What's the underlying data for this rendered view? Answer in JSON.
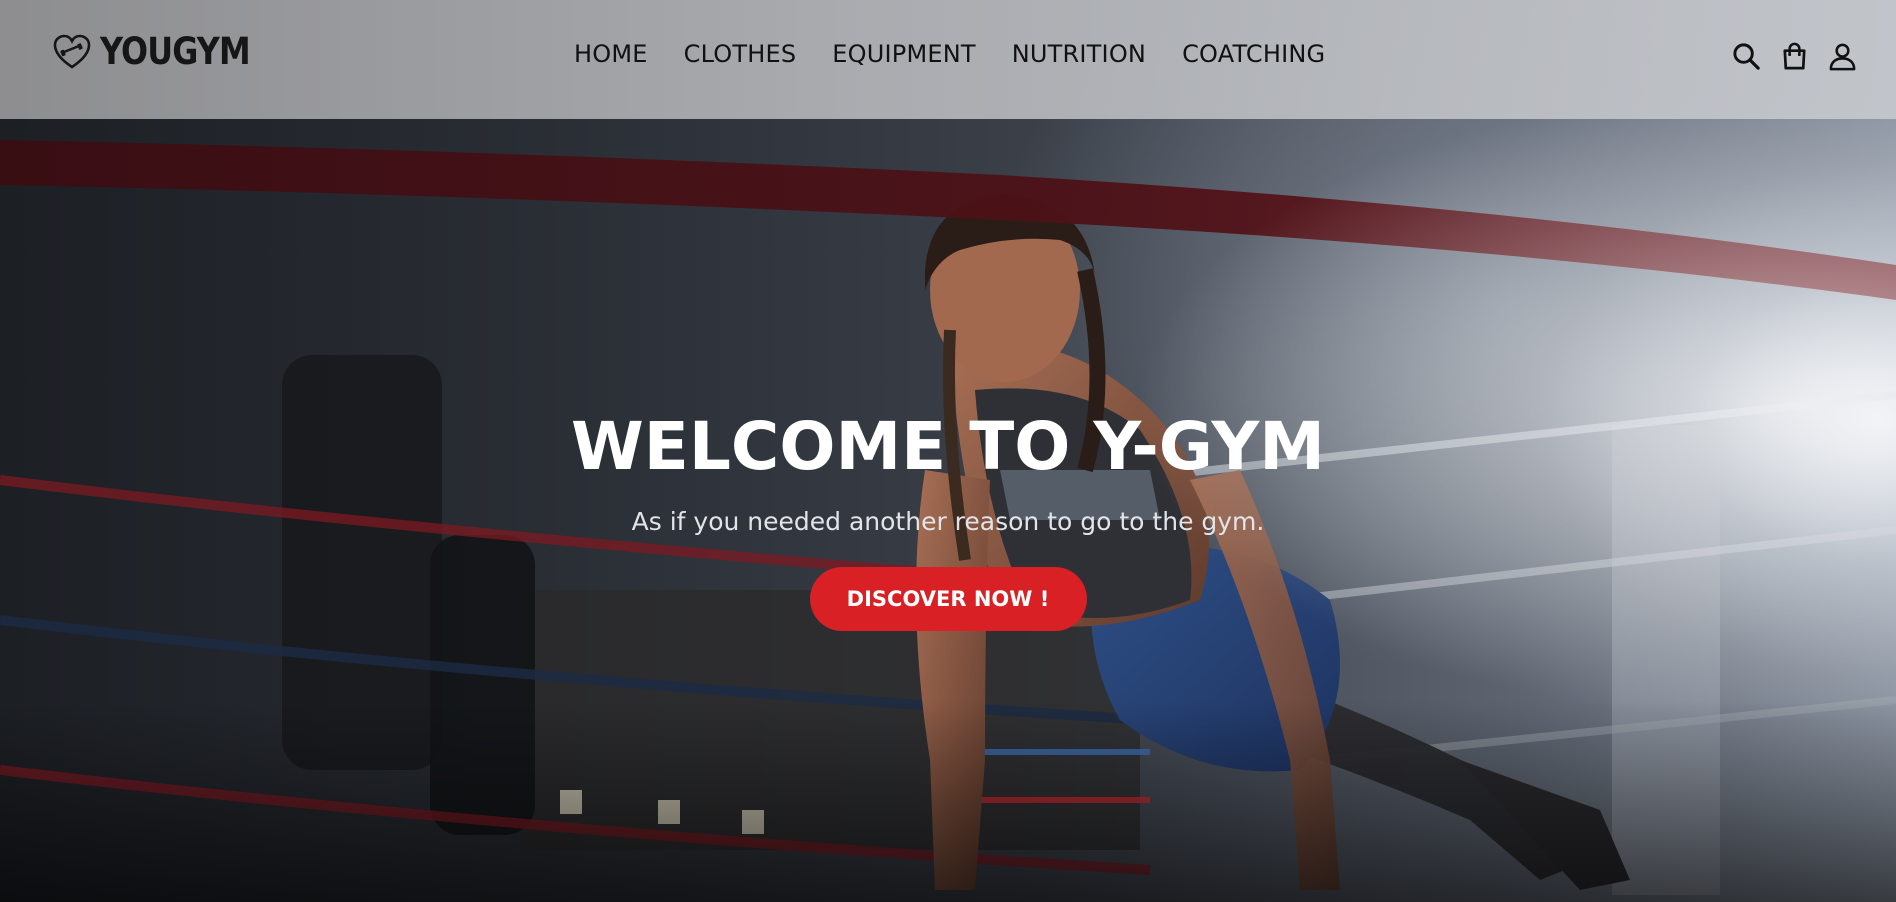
{
  "brand": {
    "name": "YOUGYM",
    "logo_icon": "heart-dumbbell-icon"
  },
  "nav": {
    "items": [
      {
        "label": "HOME"
      },
      {
        "label": "CLOTHES"
      },
      {
        "label": "EQUIPMENT"
      },
      {
        "label": "NUTRITION"
      },
      {
        "label": "COATCHING"
      }
    ]
  },
  "header_icons": [
    "search-icon",
    "shopping-bag-icon",
    "user-icon"
  ],
  "hero": {
    "title": "WELCOME TO Y-GYM",
    "subtitle": "As if you needed another reason to go to the gym.",
    "cta_label": "DISCOVER NOW !"
  },
  "colors": {
    "accent": "#d82025",
    "header_bg": "#b4b6ba",
    "text_dark": "#111111",
    "hero_text": "#ffffff"
  }
}
